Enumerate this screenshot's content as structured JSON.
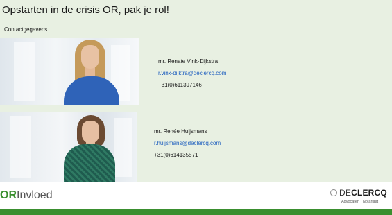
{
  "slide": {
    "title": "Opstarten in de crisis OR, pak je rol!",
    "subtitle": "Contactgegevens"
  },
  "contacts": [
    {
      "name": "mr. Renate Vink-Dijkstra",
      "email": "r.vink-dijktra@declercq.com",
      "phone": "+31(0)611397146"
    },
    {
      "name": "mr. Renée Huijsmans",
      "email": "r.huijsmans@declercq.com",
      "phone": "+31(0)614135571"
    }
  ],
  "footer": {
    "brand_left_strong": "OR",
    "brand_left_rest": "Invloed",
    "brand_right_prefix": "DE",
    "brand_right_strong": "CLERCQ",
    "brand_right_sub": "Advocaten · Notariaat"
  },
  "colors": {
    "slide_background": "#e8f0e2",
    "accent_green": "#3a8f2f",
    "link_blue": "#1f5fbf"
  }
}
